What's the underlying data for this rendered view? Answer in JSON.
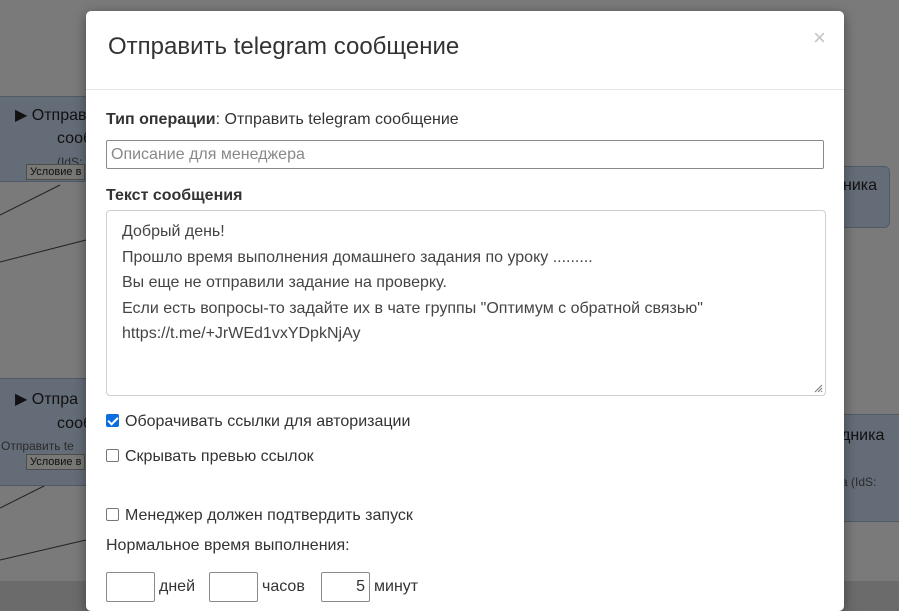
{
  "background": {
    "node1": {
      "title_a": "Отправ",
      "title_b": "сооб",
      "sub": "(IdS:"
    },
    "node2": {
      "title_a": "Отпра",
      "title_b": "сообще",
      "sub": "Отправить te"
    },
    "node3": {
      "title": "ника"
    },
    "node4": {
      "title": "дника",
      "sub": "а (IdS:"
    },
    "cond1": "Условие в",
    "cond2": "Условие в"
  },
  "modal": {
    "title": "Отправить telegram сообщение",
    "close_label": "×",
    "op_type_label": "Тип операции",
    "op_type_value": ": Отправить telegram сообщение",
    "description_placeholder": "Описание для менеджера",
    "message_label": "Текст сообщения",
    "message_lines": [
      "Добрый день!",
      "Прошло время выполнения домашнего задания по уроку .........",
      "Вы еще не отправили задание на проверку.",
      "Если есть вопросы-то задайте их в чате группы \"Оптимум с обратной связью\"",
      "https://t.me/+JrWEd1vxYDpkNjAy"
    ],
    "wrap_links": {
      "label": "Оборачивать ссылки для авторизации",
      "checked": true
    },
    "hide_preview": {
      "label": "Скрывать превью ссылок",
      "checked": false
    },
    "manager_confirm": {
      "label": "Менеджер должен подтвердить запуск",
      "checked": false
    },
    "normal_time_label": "Нормальное время выполнения:",
    "time": {
      "days_value": "",
      "days_label": "дней",
      "hours_value": "",
      "hours_label": "часов",
      "minutes_value": "5",
      "minutes_label": "минут"
    }
  }
}
